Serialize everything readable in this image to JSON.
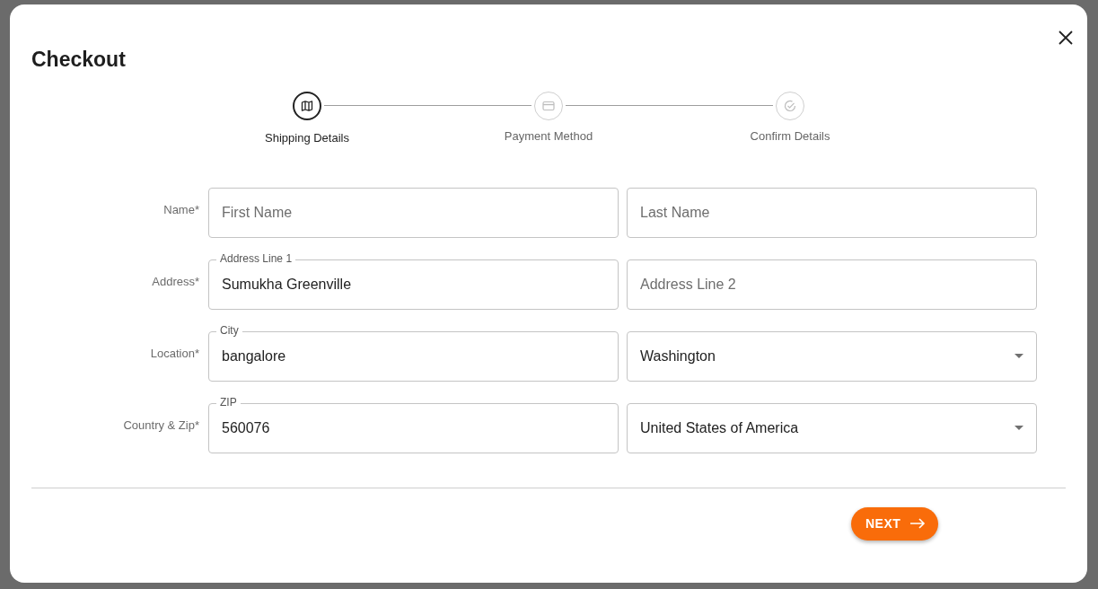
{
  "dialog": {
    "title": "Checkout"
  },
  "steps": [
    {
      "label": "Shipping Details",
      "selected": true
    },
    {
      "label": "Payment Method",
      "selected": false
    },
    {
      "label": "Confirm Details",
      "selected": false
    }
  ],
  "form_rows": [
    {
      "label": "Name*",
      "fields": [
        {
          "kind": "text",
          "placeholder": "First Name"
        },
        {
          "kind": "text",
          "placeholder": "Last Name"
        }
      ]
    },
    {
      "label": "Address*",
      "fields": [
        {
          "kind": "text",
          "label": "Address Line 1",
          "value": "Sumukha Greenville"
        },
        {
          "kind": "text",
          "placeholder": "Address Line 2"
        }
      ]
    },
    {
      "label": "Location*",
      "fields": [
        {
          "kind": "text",
          "label": "City",
          "value": "bangalore"
        },
        {
          "kind": "select",
          "value": "Washington"
        }
      ]
    },
    {
      "label": "Country & Zip*",
      "fields": [
        {
          "kind": "text",
          "label": "ZIP",
          "value": "560076"
        },
        {
          "kind": "select",
          "value": "United States of America"
        }
      ]
    }
  ],
  "next_button": {
    "label": "NEXT"
  }
}
